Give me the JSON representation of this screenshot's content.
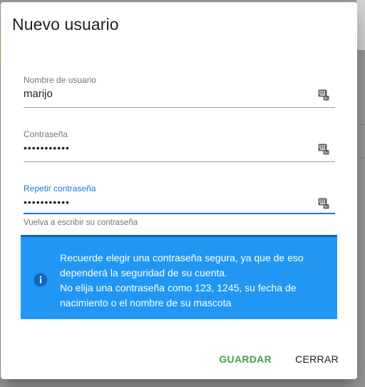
{
  "dialog": {
    "title": "Nuevo usuario",
    "fields": [
      {
        "label": "Nombre de usuario",
        "value": "marijo",
        "icon": "keyboard-icon"
      },
      {
        "label": "Contraseña",
        "value": "•••••••••••",
        "icon": "keyboard-icon"
      },
      {
        "label": "Repetir contraseña",
        "value": "•••••••••••",
        "icon": "keyboard-icon",
        "hint": "Vuelva a escribir su contraseña"
      }
    ],
    "alert": {
      "icon": "info-icon",
      "line1": "Recuerde elegir una contraseña segura, ya que de eso dependerá la seguridad de su cuenta.",
      "line2": "No elija una contraseña como 123, 1245, su fecha de nacimiento o el nombre de su mascota"
    },
    "actions": {
      "save": "GUARDAR",
      "close": "CERRAR"
    }
  },
  "colors": {
    "accent": "#1976d2",
    "alert_bg": "#2196f3",
    "save": "#43a047"
  }
}
